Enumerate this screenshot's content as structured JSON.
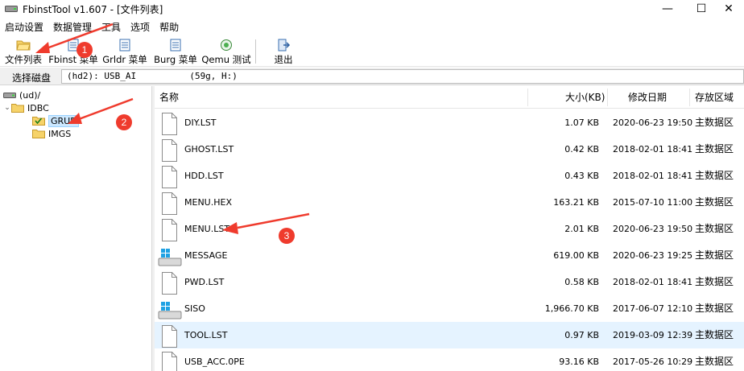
{
  "window": {
    "title": "FbinstTool v1.607 - [文件列表]",
    "controls": {
      "minimize": "—",
      "maximize": "☐",
      "close": "✕"
    }
  },
  "menu": [
    "启动设置",
    "数据管理",
    "工具",
    "选项",
    "帮助"
  ],
  "toolbar": {
    "file_list": "文件列表",
    "fbinst_menu": "Fbinst 菜单",
    "grldr_menu": "Grldr 菜单",
    "burg_menu": "Burg 菜单",
    "qemu_test": "Qemu 测试",
    "exit": "退出"
  },
  "disk": {
    "label": "选择磁盘",
    "selected": "(hd2): USB_AI          (59g, H:)"
  },
  "tree": {
    "root": "(ud)/",
    "idbc": "IDBC",
    "grub": "GRUB",
    "imgs": "IMGS"
  },
  "columns": {
    "name": "名称",
    "size": "大小(KB)",
    "date": "修改日期",
    "area": "存放区域"
  },
  "files": [
    {
      "name": "DIY.LST",
      "size": "1.07 KB",
      "date": "2020-06-23 19:50",
      "area": "主数据区",
      "icon": "document-icon"
    },
    {
      "name": "GHOST.LST",
      "size": "0.42 KB",
      "date": "2018-02-01 18:41",
      "area": "主数据区",
      "icon": "document-icon"
    },
    {
      "name": "HDD.LST",
      "size": "0.43 KB",
      "date": "2018-02-01 18:41",
      "area": "主数据区",
      "icon": "document-icon"
    },
    {
      "name": "MENU.HEX",
      "size": "163.21 KB",
      "date": "2015-07-10 11:00",
      "area": "主数据区",
      "icon": "document-icon"
    },
    {
      "name": "MENU.LST",
      "size": "2.01 KB",
      "date": "2020-06-23 19:50",
      "area": "主数据区",
      "icon": "document-icon"
    },
    {
      "name": "MESSAGE",
      "size": "619.00 KB",
      "date": "2020-06-23 19:25",
      "area": "主数据区",
      "icon": "windows-drive-icon"
    },
    {
      "name": "PWD.LST",
      "size": "0.58 KB",
      "date": "2018-02-01 18:41",
      "area": "主数据区",
      "icon": "document-icon"
    },
    {
      "name": "SISO",
      "size": "1,966.70 KB",
      "date": "2017-06-07 12:10",
      "area": "主数据区",
      "icon": "windows-drive-icon"
    },
    {
      "name": "TOOL.LST",
      "size": "0.97 KB",
      "date": "2019-03-09 12:39",
      "area": "主数据区",
      "icon": "document-icon"
    },
    {
      "name": "USB_ACC.0PE",
      "size": "93.16 KB",
      "date": "2017-05-26 10:29",
      "area": "主数据区",
      "icon": "document-icon"
    }
  ],
  "annotations": [
    "1",
    "2",
    "3"
  ],
  "colors": {
    "annotation": "#ef3b2d",
    "selection": "#cce8ff",
    "hover_row": "#e5f3ff"
  }
}
